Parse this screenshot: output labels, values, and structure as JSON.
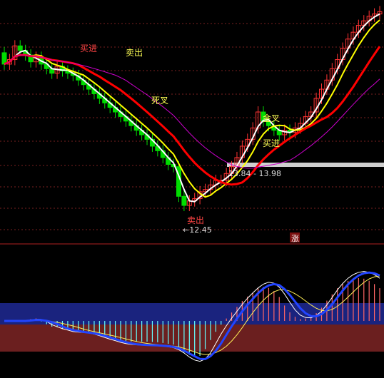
{
  "chart_data": [
    {
      "type": "candlestick",
      "panel": "main",
      "x": [
        1,
        2,
        3,
        4,
        5,
        6,
        7,
        8,
        9,
        10,
        11,
        12,
        13,
        14,
        15,
        16,
        17,
        18,
        19,
        20,
        21,
        22,
        23,
        24,
        25,
        26,
        27,
        28,
        29,
        30,
        31,
        32,
        33,
        34,
        35,
        36,
        37,
        38,
        39,
        40,
        41,
        42,
        43,
        44,
        45,
        46,
        47,
        48,
        49,
        50,
        51,
        52,
        53,
        54,
        55,
        56,
        57,
        58,
        59,
        60,
        61,
        62,
        63,
        64,
        65,
        66,
        67,
        68,
        69,
        70,
        71,
        72
      ],
      "open": [
        19.2,
        18.7,
        18.9,
        19.5,
        19.3,
        19.1,
        18.8,
        19.0,
        18.7,
        18.5,
        18.3,
        18.6,
        18.4,
        18.3,
        18.2,
        18.0,
        17.8,
        17.6,
        17.4,
        17.2,
        17.0,
        16.8,
        16.6,
        16.4,
        16.2,
        16.0,
        15.8,
        15.6,
        15.4,
        15.1,
        14.9,
        14.6,
        14.3,
        14.2,
        12.9,
        12.5,
        12.7,
        12.8,
        13.1,
        13.2,
        13.4,
        13.6,
        13.6,
        13.9,
        14.2,
        14.6,
        15.1,
        15.4,
        15.9,
        16.6,
        16.2,
        16.0,
        15.8,
        15.6,
        15.8,
        15.7,
        15.9,
        16.1,
        16.4,
        16.6,
        17.2,
        17.6,
        18.0,
        18.5,
        18.9,
        19.4,
        19.8,
        20.1,
        20.4,
        20.6,
        20.8,
        20.9
      ],
      "close": [
        18.7,
        18.9,
        19.5,
        19.3,
        19.1,
        18.8,
        19.0,
        18.7,
        18.5,
        18.3,
        18.6,
        18.4,
        18.3,
        18.2,
        18.0,
        17.8,
        17.6,
        17.4,
        17.2,
        17.0,
        16.8,
        16.6,
        16.4,
        16.2,
        16.0,
        15.8,
        15.6,
        15.4,
        15.1,
        14.9,
        14.6,
        14.3,
        14.2,
        12.9,
        12.5,
        12.7,
        12.8,
        13.1,
        13.2,
        13.4,
        13.6,
        13.6,
        13.9,
        14.2,
        14.6,
        15.1,
        15.4,
        15.9,
        16.6,
        16.2,
        16.0,
        15.8,
        15.6,
        15.8,
        15.7,
        15.9,
        16.1,
        16.4,
        16.6,
        17.2,
        17.6,
        18.0,
        18.5,
        18.9,
        19.4,
        19.8,
        20.1,
        20.4,
        20.6,
        20.8,
        20.9,
        21.0
      ],
      "price_labels": {
        "low_marker": "←12.45",
        "range_marker": "13.84 - 13.98"
      },
      "annotations": [
        "买进",
        "卖出",
        "死叉",
        "卖出",
        "买进",
        "金叉"
      ],
      "badge": "涨",
      "moving_average_colors": [
        "#ffffff",
        "#ffff00",
        "#ff0000",
        "#cc00cc"
      ],
      "up_color": "#ff3333",
      "down_color": "#00dd00",
      "hollow_color": "#00ffff"
    },
    {
      "type": "oscillator",
      "panel": "sub",
      "histogram_up_color": "#ff6666",
      "histogram_down_color": "#66ffff",
      "line_colors": [
        "#ffffff",
        "#ffee55",
        "#2244ff",
        "#33cc33"
      ],
      "band_colors": [
        "#1a237e",
        "#6b1f1f"
      ]
    }
  ]
}
